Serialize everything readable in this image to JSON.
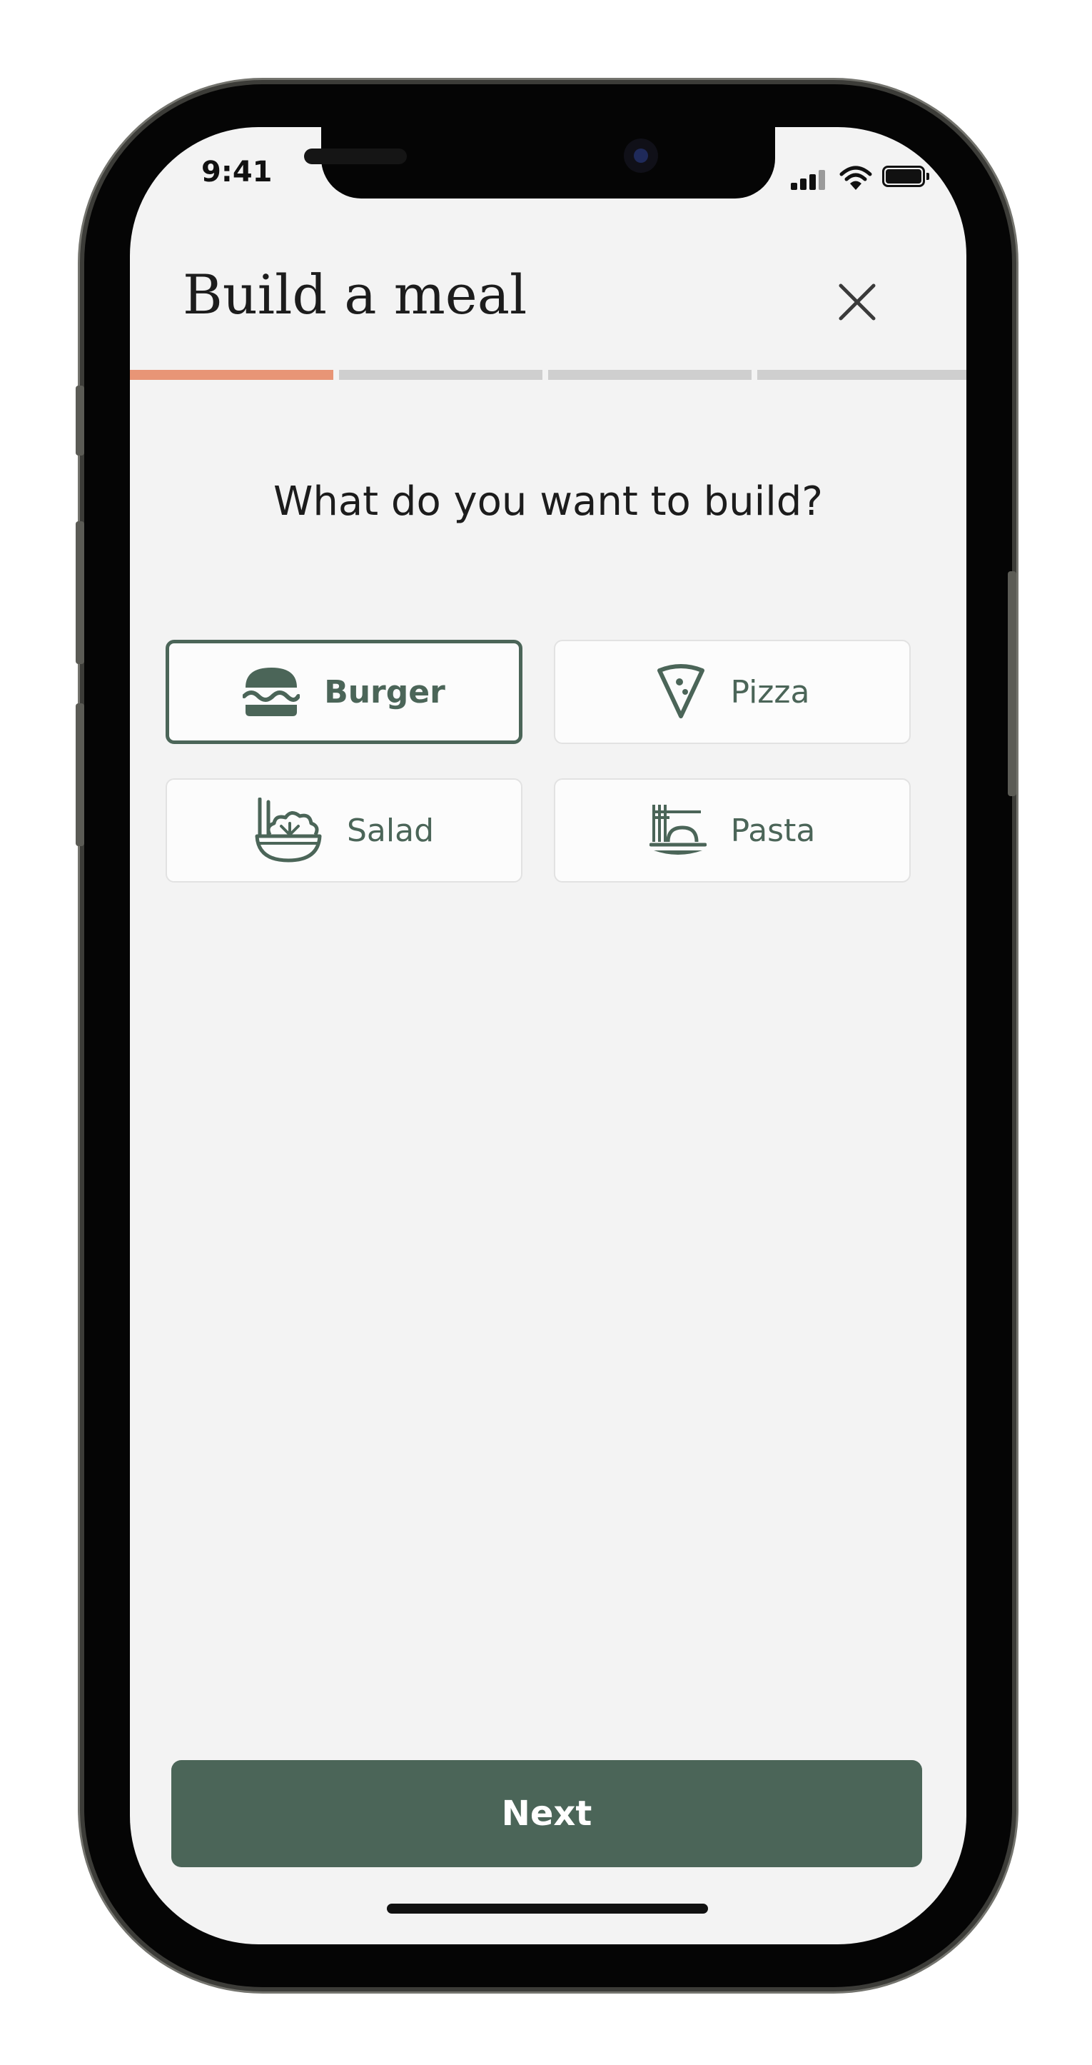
{
  "status_bar": {
    "time": "9:41",
    "icons": [
      "signal-icon",
      "wifi-icon",
      "battery-icon"
    ]
  },
  "header": {
    "title": "Build a meal",
    "close_icon": "close-icon"
  },
  "progress": {
    "steps_total": 4,
    "current_step": 1,
    "active_color": "#e89576",
    "inactive_color": "#cfcfcf"
  },
  "question": "What do you want to build?",
  "options": [
    {
      "label": "Burger",
      "icon": "burger-icon",
      "selected": true
    },
    {
      "label": "Pizza",
      "icon": "pizza-icon",
      "selected": false
    },
    {
      "label": "Salad",
      "icon": "salad-icon",
      "selected": false
    },
    {
      "label": "Pasta",
      "icon": "pasta-icon",
      "selected": false
    }
  ],
  "footer": {
    "next_label": "Next"
  },
  "colors": {
    "accent": "#4b6558",
    "background": "#f3f3f3",
    "progress_active": "#e89576"
  }
}
